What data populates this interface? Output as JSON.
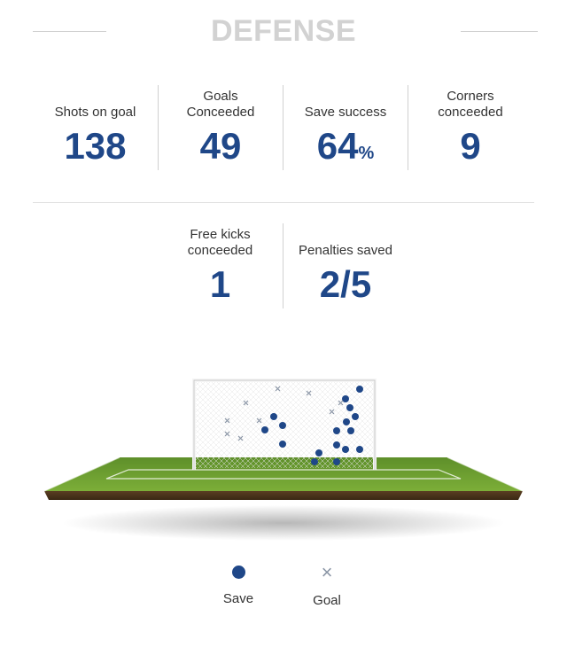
{
  "section": {
    "title": "DEFENSE"
  },
  "stats_row1": [
    {
      "label": "Shots on goal",
      "value": "138",
      "suffix": ""
    },
    {
      "label": "Goals\nConceeded",
      "value": "49",
      "suffix": ""
    },
    {
      "label": "Save success",
      "value": "64",
      "suffix": "%"
    },
    {
      "label": "Corners\nconceeded",
      "value": "9",
      "suffix": ""
    }
  ],
  "stats_row2": [
    {
      "label": "Free kicks\nconceeded",
      "value": "1",
      "suffix": ""
    },
    {
      "label": "Penalties saved",
      "value": "2/5",
      "suffix": ""
    }
  ],
  "legend": {
    "save_label": "Save",
    "goal_label": "Goal"
  },
  "colors": {
    "accent": "#1f4788",
    "title": "#d2d2d2",
    "goal_marker": "#8a95a5",
    "grass": "#6a9a2f"
  },
  "icons": {
    "save": "dot-icon",
    "goal": "x-icon"
  }
}
